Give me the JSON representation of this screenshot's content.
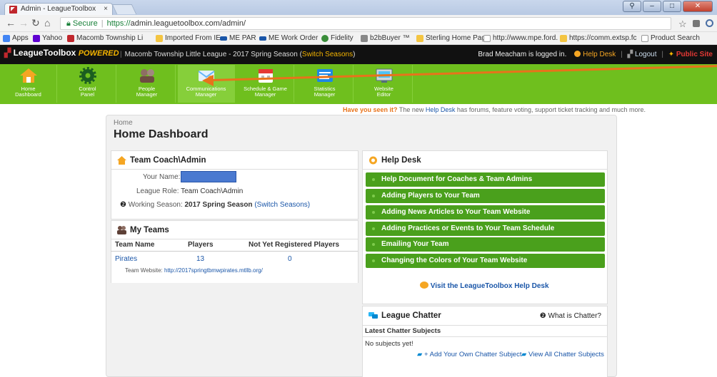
{
  "browser": {
    "tab_title": "Admin - LeagueToolbox",
    "url_secure": "Secure",
    "url_scheme": "https://",
    "url_rest": "admin.leaguetoolbox.com/admin/",
    "bookmarks": [
      "Apps",
      "Yahoo",
      "Macomb Township Li",
      "Imported From IE",
      "ME PAR",
      "ME Work Order",
      "Fidelity",
      "b2bBuyer ™",
      "Sterling Home Page",
      "http://www.mpe.ford.",
      "https://comm.extsp.fc",
      "Product Search"
    ]
  },
  "topbar": {
    "logo": "LeagueToolbox",
    "logo_powered": "POWERED",
    "season": "Macomb Township Little League - 2017 Spring Season (",
    "switch": "Switch Seasons",
    "season_end": ")",
    "logged_in": "Brad Meacham is logged in.",
    "help_desk": "Help Desk",
    "logout": "Logout",
    "public_site": "Public Site"
  },
  "menu": [
    {
      "line1": "Home",
      "line2": "Dashboard",
      "icon": "home-icon",
      "color": "#f39c12"
    },
    {
      "line1": "Control",
      "line2": "Panel",
      "icon": "gear-icon",
      "color": "#2e7d32"
    },
    {
      "line1": "People",
      "line2": "Manager",
      "icon": "people-icon",
      "color": "#8d6e63"
    },
    {
      "line1": "Communications",
      "line2": "Manager",
      "icon": "mail-icon",
      "color": "#64b5f6"
    },
    {
      "line1": "Schedule & Game",
      "line2": "Manager",
      "icon": "calendar-icon",
      "color": "#e57373"
    },
    {
      "line1": "Statistics",
      "line2": "Manager",
      "icon": "stats-icon",
      "color": "#1e88e5"
    },
    {
      "line1": "Website",
      "line2": "Editor",
      "icon": "website-icon",
      "color": "#90a4ae"
    }
  ],
  "notice": {
    "lead": "Have you seen it?",
    "text1": " The new ",
    "link": "Help Desk",
    "text2": " has forums, feature voting, support ticket tracking and much more."
  },
  "page": {
    "breadcrumb": "Home",
    "title": "Home Dashboard"
  },
  "coach_box": {
    "title": "Team Coach\\Admin",
    "name_label": "Your Name:",
    "role_label": "League Role:",
    "role_value": "Team Coach\\Admin",
    "season_label": "Working Season:",
    "season_value": "2017 Spring Season",
    "season_switch": "(Switch Seasons)"
  },
  "teams_box": {
    "title": "My Teams",
    "columns": [
      "Team Name",
      "Players",
      "Not Yet Registered Players"
    ],
    "rows": [
      {
        "name": "Pirates",
        "players": "13",
        "unregistered": "0"
      }
    ],
    "website_label": "Team Website:",
    "website_url": "http://2017springtbmwpirates.mtllb.org/"
  },
  "helpdesk_box": {
    "title": "Help Desk",
    "items": [
      "Help Document for Coaches & Team Admins",
      "Adding Players to Your Team",
      "Adding News Articles to Your Team Website",
      "Adding Practices or Events to Your Team Schedule",
      "Emailing Your Team",
      "Changing the Colors of Your Team Website"
    ],
    "visit": "Visit the LeagueToolbox Help Desk"
  },
  "chatter_box": {
    "title": "League Chatter",
    "what": "What is Chatter?",
    "latest": "Latest Chatter Subjects",
    "empty": "No subjects yet!",
    "add": "+ Add Your Own Chatter Subject",
    "view_all": "View All Chatter Subjects"
  }
}
